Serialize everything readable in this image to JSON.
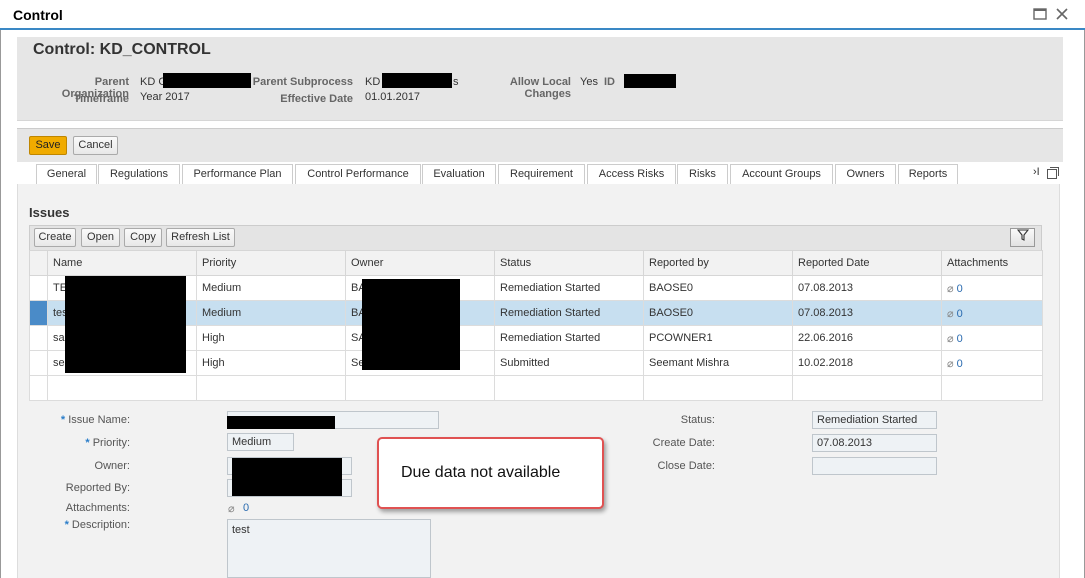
{
  "window": {
    "title": "Control",
    "maximize_icon": "maximize-icon",
    "close_icon": "close-icon"
  },
  "header": {
    "title": "Control: KD_CONTROL",
    "parent_org_label": "Parent Organization",
    "parent_org_value": "KD G",
    "parent_subprocess_label": "Parent Subprocess",
    "parent_subprocess_value": "KD",
    "parent_subprocess_suffix": "s",
    "allow_local_label": "Allow Local Changes",
    "allow_local_value": "Yes",
    "id_label": "ID",
    "timeframe_label": "Timeframe",
    "timeframe_value": "Year 2017",
    "effective_date_label": "Effective Date",
    "effective_date_value": "01.01.2017"
  },
  "toolbar": {
    "save_label": "Save",
    "cancel_label": "Cancel"
  },
  "tabs": [
    {
      "label": "General"
    },
    {
      "label": "Regulations"
    },
    {
      "label": "Performance Plan"
    },
    {
      "label": "Control Performance"
    },
    {
      "label": "Evaluation"
    },
    {
      "label": "Requirement"
    },
    {
      "label": "Access Risks"
    },
    {
      "label": "Risks"
    },
    {
      "label": "Account Groups"
    },
    {
      "label": "Owners"
    },
    {
      "label": "Reports"
    }
  ],
  "tab_overflow": "›I",
  "issues": {
    "title": "Issues",
    "create_label": "Create",
    "open_label": "Open",
    "copy_label": "Copy",
    "refresh_label": "Refresh List",
    "filter_icon": "filter-icon",
    "columns": [
      "Name",
      "Priority",
      "Owner",
      "Status",
      "Reported by",
      "Reported Date",
      "Attachments"
    ],
    "rows": [
      {
        "name": "TE",
        "priority": "Medium",
        "owner": "BA",
        "status": "Remediation Started",
        "reported_by": "BAOSE0",
        "reported_date": "07.08.2013",
        "attachments": "0"
      },
      {
        "name": "tes",
        "priority": "Medium",
        "owner": "BA",
        "status": "Remediation Started",
        "reported_by": "BAOSE0",
        "reported_date": "07.08.2013",
        "attachments": "0"
      },
      {
        "name": "sac",
        "priority": "High",
        "owner": "SA",
        "status": "Remediation Started",
        "reported_by": "PCOWNER1",
        "reported_date": "22.06.2016",
        "attachments": "0"
      },
      {
        "name": "see",
        "priority": "High",
        "owner": "Se",
        "status": "Submitted",
        "reported_by": "Seemant Mishra",
        "reported_date": "10.02.2018",
        "attachments": "0"
      }
    ]
  },
  "details": {
    "issue_name_label": "Issue Name:",
    "priority_label": "Priority:",
    "priority_value": "Medium",
    "owner_label": "Owner:",
    "reported_by_label": "Reported By:",
    "attachments_label": "Attachments:",
    "attachments_value": "0",
    "description_label": "Description:",
    "description_value": "test",
    "status_label": "Status:",
    "status_value": "Remediation Started",
    "create_date_label": "Create Date:",
    "create_date_value": "07.08.2013",
    "close_date_label": "Close Date:",
    "close_date_value": "",
    "required_marker": "*"
  },
  "callout": {
    "text": "Due data not available"
  }
}
